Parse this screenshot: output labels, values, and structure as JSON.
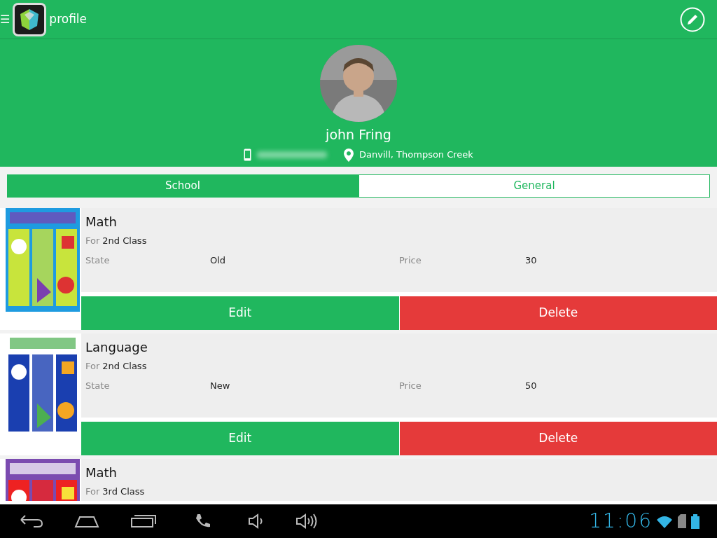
{
  "app_bar": {
    "title": "profile",
    "menu_glyph": "☰"
  },
  "profile": {
    "name": "john Fring",
    "location": "Danvill, Thompson Creek"
  },
  "tabs": [
    {
      "label": "School",
      "selected": true
    },
    {
      "label": "General",
      "selected": false
    }
  ],
  "books": [
    {
      "subject": "Math",
      "for_label": "For",
      "class": "2nd Class",
      "state_label": "State",
      "state": "Old",
      "price_label": "Price",
      "price": "30",
      "buttons": [
        "Edit",
        "Delete"
      ]
    },
    {
      "subject": "Language",
      "for_label": "For",
      "class": "2nd Class",
      "state_label": "State",
      "state": "New",
      "price_label": "Price",
      "price": "50",
      "buttons": [
        "Edit",
        "Delete"
      ]
    },
    {
      "subject": "Math",
      "for_label": "For",
      "class": "3rd Class"
    }
  ],
  "status_bar": {
    "time": "11:06"
  }
}
